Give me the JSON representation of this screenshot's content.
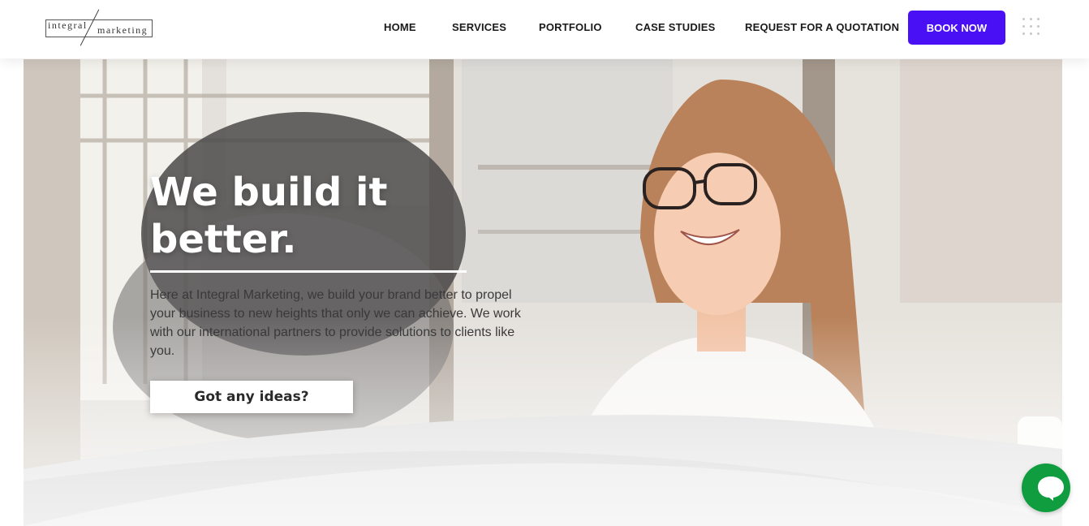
{
  "header": {
    "logo_word1": "integral",
    "logo_word2": "marketing",
    "nav": [
      "HOME",
      "SERVICES",
      "PORTFOLIO",
      "CASE STUDIES",
      "REQUEST FOR A QUOTATION"
    ],
    "book_label": "BOOK NOW",
    "menu_icon": "grid-menu-icon"
  },
  "hero": {
    "headline": "We build it better.",
    "description": "Here at Integral Marketing, we build your brand better to propel your business to new heights that only we can achieve. We work with our international partners to provide solutions to clients like you.",
    "cta_label": "Got any ideas?"
  },
  "chat": {
    "icon": "chat-bubble-icon"
  },
  "colors": {
    "accent": "#4a10f5",
    "chat": "#0f9d3f",
    "text": "#1a1a1a"
  }
}
